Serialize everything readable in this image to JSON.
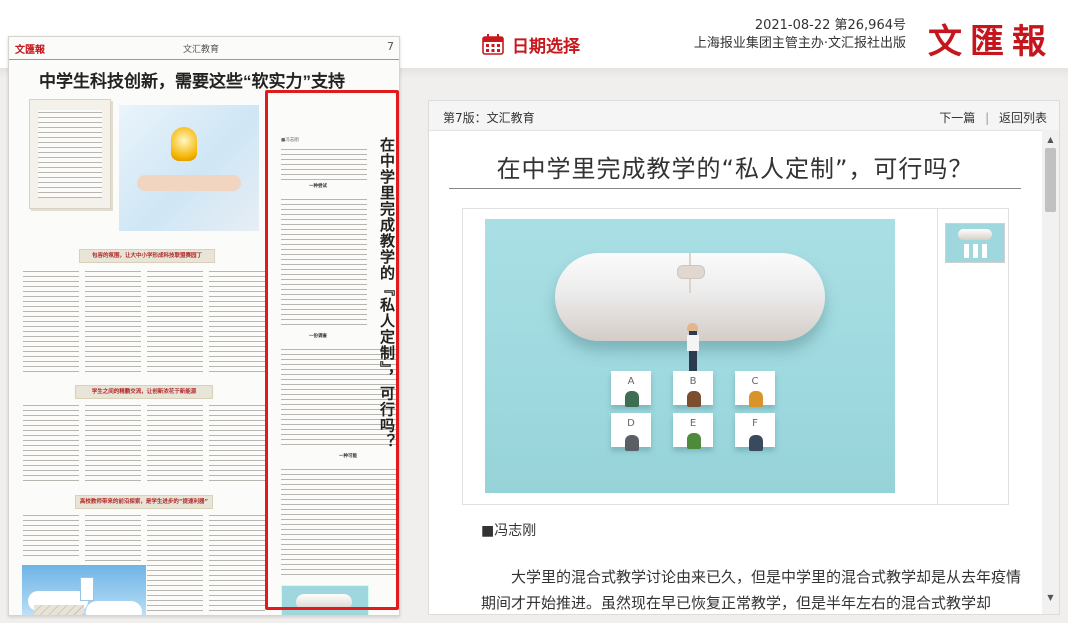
{
  "header": {
    "date_picker_label": "日期选择",
    "date_line": "2021-08-22 第26,964号",
    "publisher_line": "上海报业集团主管主办·文汇报社出版",
    "logo_text": "文匯報",
    "accent_color": "#c8191e"
  },
  "newspaper_page": {
    "masthead": "文匯報",
    "section": "文汇教育",
    "page_number": "7",
    "headline": "中学生科技创新，需要这些“软实力”支持",
    "subheads": [
      "包容的氛围，让大中小学形成科技联盟赛园丁",
      "学生之间的精鹏交流，让创新浓花于新能源",
      "高校教师带来的前沿探索，是学生进步的“提速利器”"
    ],
    "highlighted_article": {
      "vertical_title": "在中学里完成教学的『私人定制』，可行吗？",
      "author": "■冯志刚",
      "section_marks": [
        "一种尝试",
        "一份调查",
        "一种可能"
      ]
    },
    "highlight_color": "#e11b1b"
  },
  "article_panel": {
    "edition": "第7版：文汇教育",
    "next_link": "下一篇",
    "separator": "|",
    "back_link": "返回列表",
    "title": "在中学里完成教学的“私人定制”，可行吗？",
    "byline": "■冯志刚",
    "body_first_paragraph": "大学里的混合式教学讨论由来已久，但是中学里的混合式教学却是从去年疫情期间才开始推进。虽然现在早已恢复正常教学，但是半年左右的混合式教学却",
    "photo_desk_labels": [
      "A",
      "B",
      "C",
      "D",
      "E",
      "F"
    ]
  },
  "icons": {
    "calendar": "calendar-icon",
    "scroll_up": "chevron-up-icon",
    "scroll_down": "chevron-down-icon",
    "scroll_up_glyph": "▲",
    "scroll_down_glyph": "▼"
  }
}
